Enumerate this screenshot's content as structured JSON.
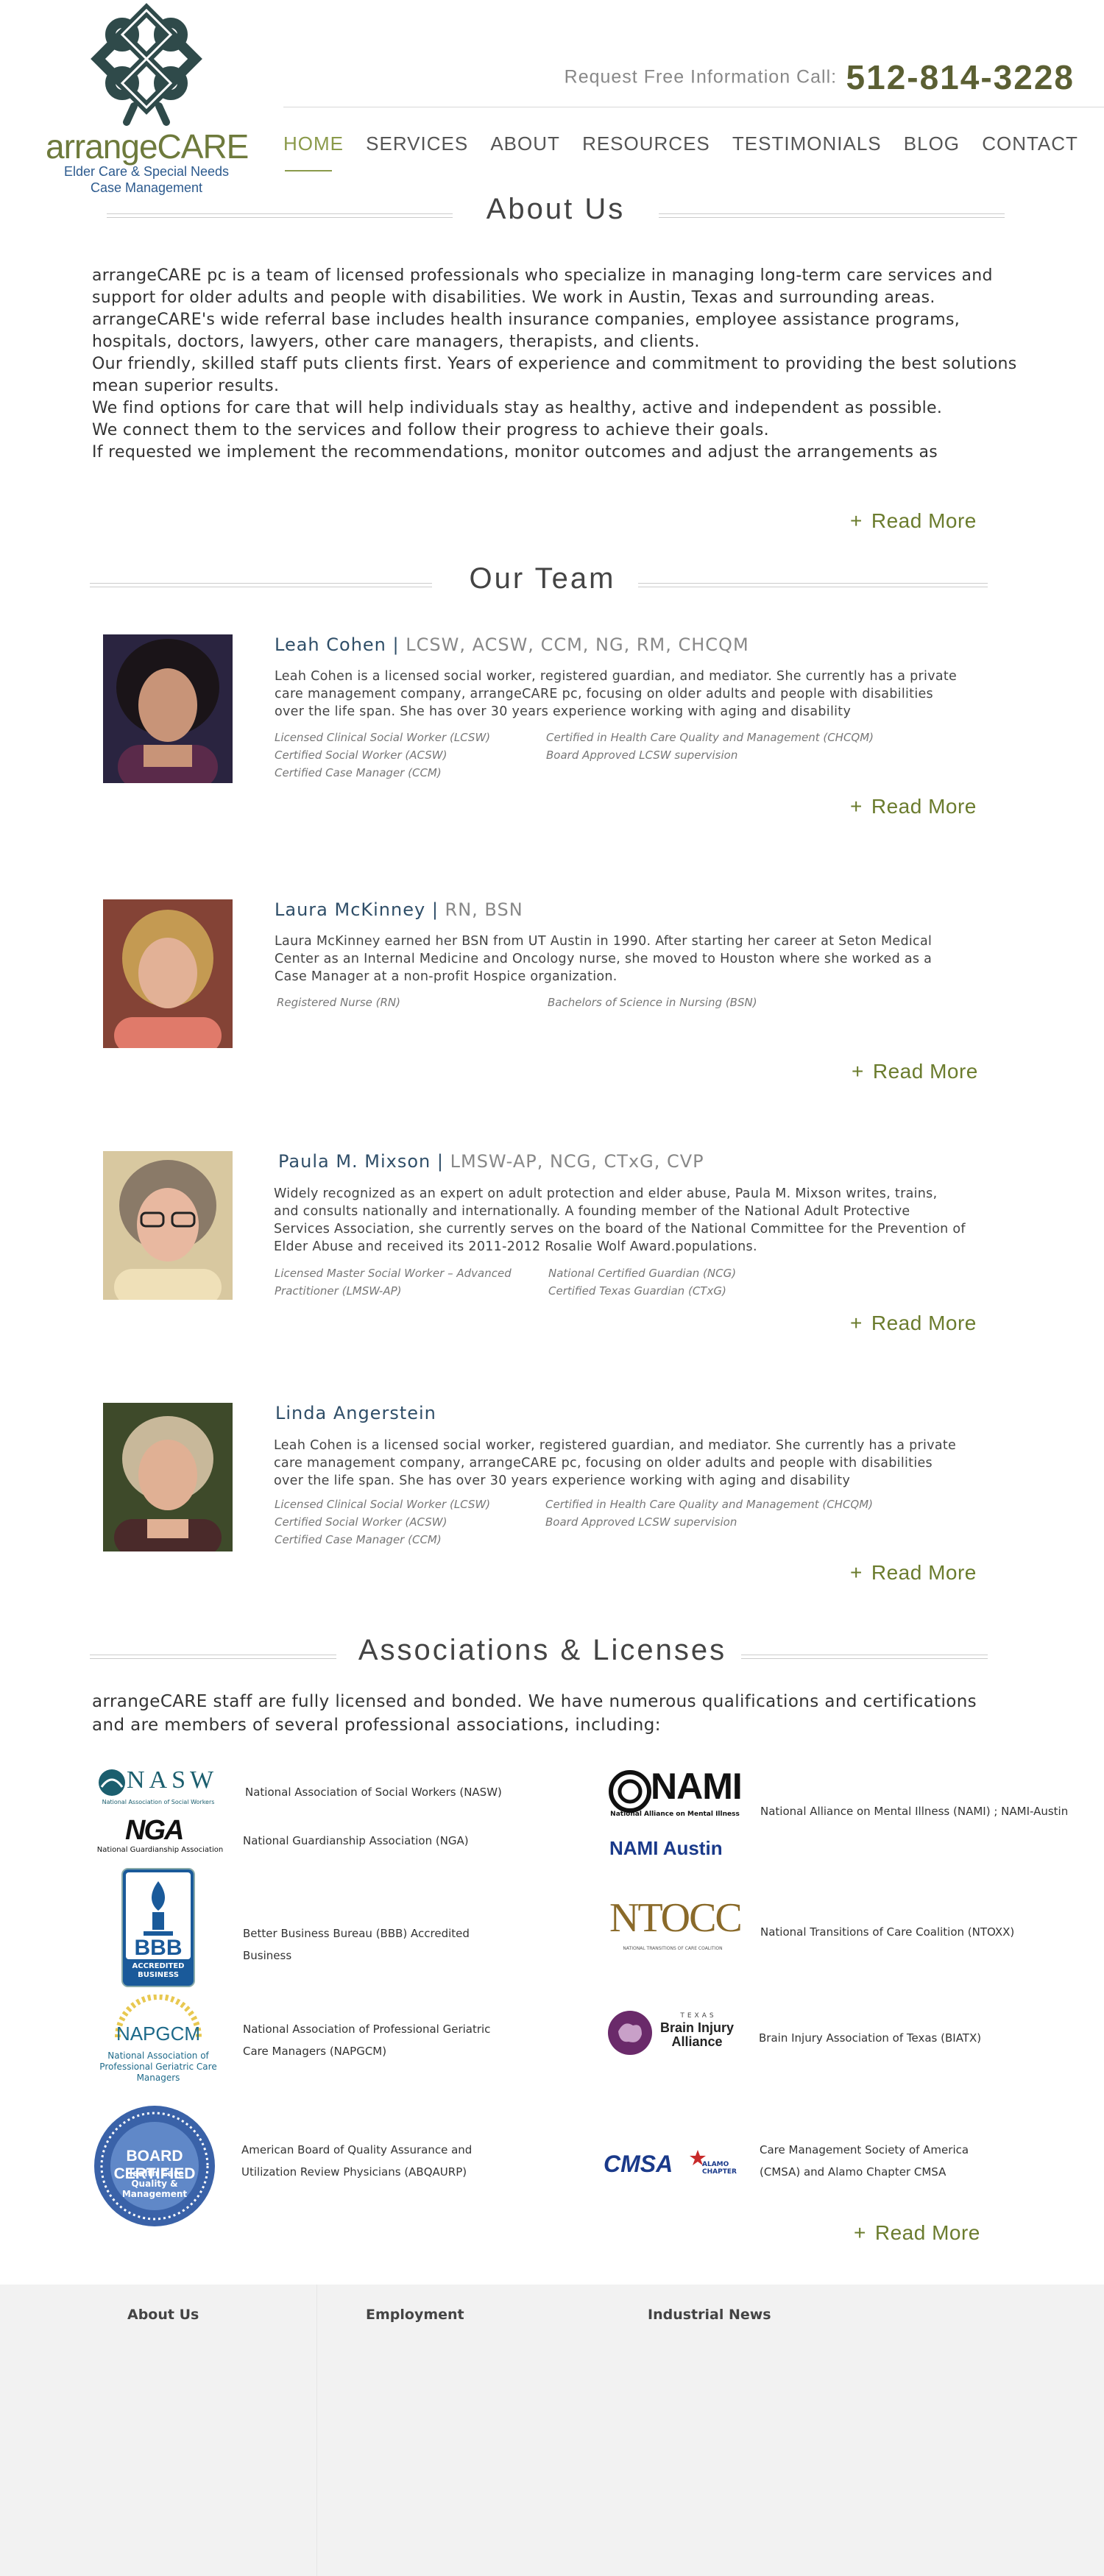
{
  "header": {
    "logo_word": "arrangeCARE",
    "logo_tagline_1": "Elder Care & Special Needs",
    "logo_tagline_2": "Case Management",
    "call_label": "Request Free Information Call:",
    "phone": "512-814-3228"
  },
  "nav": {
    "items": [
      {
        "label": "HOME",
        "active": true
      },
      {
        "label": "SERVICES"
      },
      {
        "label": "ABOUT"
      },
      {
        "label": "RESOURCES"
      },
      {
        "label": "TESTIMONIALS"
      },
      {
        "label": "BLOG"
      },
      {
        "label": "CONTACT"
      }
    ]
  },
  "about": {
    "title": "About Us",
    "paragraphs": [
      "arrangeCARE pc is a team of licensed professionals who specialize in managing long-term care services and support for older adults and people with disabilities. We work in Austin, Texas and surrounding areas.",
      "arrangeCARE's wide referral base includes health insurance companies, employee assistance programs, hospitals, doctors, lawyers, other care managers, therapists, and clients.",
      "Our friendly, skilled staff puts clients first. Years of experience and commitment to providing the best solutions mean superior results.",
      "We find options for care that will help individuals stay as healthy, active and independent as possible.",
      "We connect them to the services and follow their progress to achieve their goals.",
      "If requested we implement the recommendations, monitor outcomes and adjust the arrangements as"
    ],
    "read_more": "Read More"
  },
  "team": {
    "title": "Our Team",
    "members": [
      {
        "name": "Leah Cohen",
        "sep": " | ",
        "credentials": "LCSW,  ACSW,  CCM,  NG, RM, CHCQM",
        "bio": "Leah Cohen is a licensed social worker, registered guardian, and mediator. She currently has a private care management company, arrangeCARE pc, focusing on older adults and people with disabilities over the life span. She has over 30 years experience working with aging and disability",
        "certs_left": [
          "Licensed Clinical Social Worker (LCSW)",
          "Certified Social Worker (ACSW)",
          "Certified Case Manager (CCM)"
        ],
        "certs_right": [
          "Certified in Health Care Quality and Management (CHCQM)",
          "Board Approved LCSW supervision"
        ],
        "read_more": "Read More"
      },
      {
        "name": "Laura McKinney",
        "sep": " | ",
        "credentials": "RN, BSN",
        "bio": "Laura McKinney earned her BSN from UT Austin in 1990. After starting her career at Seton Medical Center as an Internal Medicine and Oncology nurse, she moved to Houston where she worked as a Case Manager at a non-profit Hospice organization.",
        "certs_left": [
          "Registered Nurse (RN)"
        ],
        "certs_right": [
          "Bachelors of Science in Nursing (BSN)"
        ],
        "read_more": "Read More"
      },
      {
        "name": "Paula M. Mixson",
        "sep": " | ",
        "credentials": "LMSW-AP, NCG, CTxG, CVP",
        "bio": "Widely recognized as an expert on adult protection and elder abuse, Paula M. Mixson writes, trains, and consults nationally and internationally. A founding member of the National Adult Protective Services Association, she currently serves on the board of the National Committee for the Prevention of Elder Abuse and received its 2011-2012 Rosalie Wolf Award.populations.",
        "certs_left": [
          "Licensed Master Social Worker – Advanced Practitioner (LMSW-AP)"
        ],
        "certs_right": [
          "National Certified Guardian (NCG)",
          "Certified Texas Guardian (CTxG)"
        ],
        "read_more": "Read More"
      },
      {
        "name": "Linda Angerstein",
        "sep": "",
        "credentials": "",
        "bio": "Leah Cohen is a licensed social worker, registered guardian, and mediator. She currently has a private care management company, arrangeCARE pc, focusing on older adults and people with disabilities over the life span. She has over 30 years experience working with aging and disability",
        "certs_left": [
          "Licensed Clinical Social Worker (LCSW)",
          "Certified Social Worker (ACSW)",
          "Certified Case Manager (CCM)"
        ],
        "certs_right": [
          "Certified in Health Care Quality and Management (CHCQM)",
          "Board Approved LCSW supervision"
        ],
        "read_more": "Read More"
      }
    ]
  },
  "associations": {
    "title": "Associations & Licenses",
    "intro": "arrangeCARE staff are fully licensed and bonded. We have numerous qualifications and certifications and are members of several professional associations, including:",
    "items": [
      {
        "logo": "NASW",
        "logo_sub": "National Association of Social Workers",
        "text": "National Association of Social Workers (NASW)"
      },
      {
        "logo": "NGA",
        "logo_sub": "National Guardianship Association",
        "text": "National Guardianship Association (NGA)"
      },
      {
        "logo": "BBB",
        "logo_sub": "ACCREDITED BUSINESS",
        "text": "Better Business Bureau (BBB) Accredited Business"
      },
      {
        "logo": "NAPGCM",
        "logo_sub": "National Association of Professional Geriatric Care Managers",
        "text": "National Association of Professional Geriatric Care Managers (NAPGCM)"
      },
      {
        "logo": "BOARD CERTIFIED",
        "logo_sub": "Health Care Quality & Management",
        "text": "American Board of Quality Assurance and Utilization Review Physicians (ABQAURP)"
      },
      {
        "logo": "NAMI",
        "logo_sub": "National Alliance on Mental Illness",
        "logo2": "NAMI Austin",
        "text": "National Alliance on Mental Illness (NAMI) ; NAMI-Austin"
      },
      {
        "logo": "NTOCC",
        "logo_sub": "NATIONAL TRANSITIONS OF CARE COALITION",
        "text": "National Transitions of Care Coalition (NTOXX)"
      },
      {
        "logo": "Brain Injury Alliance",
        "logo_sub": "TEXAS",
        "text": "Brain Injury Association of Texas (BIATX)"
      },
      {
        "logo": "CMSA",
        "logo2": "ALAMO CHAPTER",
        "text": "Care Management Society of America (CMSA) and Alamo Chapter CMSA"
      }
    ],
    "read_more": "Read More"
  },
  "footer": {
    "columns": [
      "About Us",
      "Employment",
      "Industrial News"
    ]
  },
  "colors": {
    "accent_green": "#6b7c2e",
    "name_blue": "#2f4e68",
    "logo_blue": "#2c5a8e",
    "footer_bg": "#f2f2f2"
  }
}
